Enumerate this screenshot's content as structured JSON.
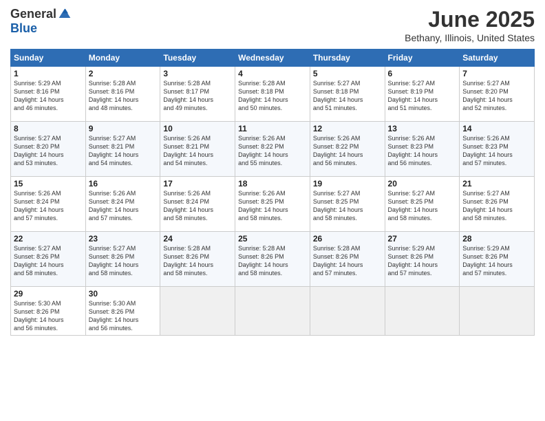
{
  "header": {
    "logo_general": "General",
    "logo_blue": "Blue",
    "month": "June 2025",
    "location": "Bethany, Illinois, United States"
  },
  "weekdays": [
    "Sunday",
    "Monday",
    "Tuesday",
    "Wednesday",
    "Thursday",
    "Friday",
    "Saturday"
  ],
  "weeks": [
    [
      {
        "day": "1",
        "info": "Sunrise: 5:29 AM\nSunset: 8:16 PM\nDaylight: 14 hours\nand 46 minutes."
      },
      {
        "day": "2",
        "info": "Sunrise: 5:28 AM\nSunset: 8:16 PM\nDaylight: 14 hours\nand 48 minutes."
      },
      {
        "day": "3",
        "info": "Sunrise: 5:28 AM\nSunset: 8:17 PM\nDaylight: 14 hours\nand 49 minutes."
      },
      {
        "day": "4",
        "info": "Sunrise: 5:28 AM\nSunset: 8:18 PM\nDaylight: 14 hours\nand 50 minutes."
      },
      {
        "day": "5",
        "info": "Sunrise: 5:27 AM\nSunset: 8:18 PM\nDaylight: 14 hours\nand 51 minutes."
      },
      {
        "day": "6",
        "info": "Sunrise: 5:27 AM\nSunset: 8:19 PM\nDaylight: 14 hours\nand 51 minutes."
      },
      {
        "day": "7",
        "info": "Sunrise: 5:27 AM\nSunset: 8:20 PM\nDaylight: 14 hours\nand 52 minutes."
      }
    ],
    [
      {
        "day": "8",
        "info": "Sunrise: 5:27 AM\nSunset: 8:20 PM\nDaylight: 14 hours\nand 53 minutes."
      },
      {
        "day": "9",
        "info": "Sunrise: 5:27 AM\nSunset: 8:21 PM\nDaylight: 14 hours\nand 54 minutes."
      },
      {
        "day": "10",
        "info": "Sunrise: 5:26 AM\nSunset: 8:21 PM\nDaylight: 14 hours\nand 54 minutes."
      },
      {
        "day": "11",
        "info": "Sunrise: 5:26 AM\nSunset: 8:22 PM\nDaylight: 14 hours\nand 55 minutes."
      },
      {
        "day": "12",
        "info": "Sunrise: 5:26 AM\nSunset: 8:22 PM\nDaylight: 14 hours\nand 56 minutes."
      },
      {
        "day": "13",
        "info": "Sunrise: 5:26 AM\nSunset: 8:23 PM\nDaylight: 14 hours\nand 56 minutes."
      },
      {
        "day": "14",
        "info": "Sunrise: 5:26 AM\nSunset: 8:23 PM\nDaylight: 14 hours\nand 57 minutes."
      }
    ],
    [
      {
        "day": "15",
        "info": "Sunrise: 5:26 AM\nSunset: 8:24 PM\nDaylight: 14 hours\nand 57 minutes."
      },
      {
        "day": "16",
        "info": "Sunrise: 5:26 AM\nSunset: 8:24 PM\nDaylight: 14 hours\nand 57 minutes."
      },
      {
        "day": "17",
        "info": "Sunrise: 5:26 AM\nSunset: 8:24 PM\nDaylight: 14 hours\nand 58 minutes."
      },
      {
        "day": "18",
        "info": "Sunrise: 5:26 AM\nSunset: 8:25 PM\nDaylight: 14 hours\nand 58 minutes."
      },
      {
        "day": "19",
        "info": "Sunrise: 5:27 AM\nSunset: 8:25 PM\nDaylight: 14 hours\nand 58 minutes."
      },
      {
        "day": "20",
        "info": "Sunrise: 5:27 AM\nSunset: 8:25 PM\nDaylight: 14 hours\nand 58 minutes."
      },
      {
        "day": "21",
        "info": "Sunrise: 5:27 AM\nSunset: 8:26 PM\nDaylight: 14 hours\nand 58 minutes."
      }
    ],
    [
      {
        "day": "22",
        "info": "Sunrise: 5:27 AM\nSunset: 8:26 PM\nDaylight: 14 hours\nand 58 minutes."
      },
      {
        "day": "23",
        "info": "Sunrise: 5:27 AM\nSunset: 8:26 PM\nDaylight: 14 hours\nand 58 minutes."
      },
      {
        "day": "24",
        "info": "Sunrise: 5:28 AM\nSunset: 8:26 PM\nDaylight: 14 hours\nand 58 minutes."
      },
      {
        "day": "25",
        "info": "Sunrise: 5:28 AM\nSunset: 8:26 PM\nDaylight: 14 hours\nand 58 minutes."
      },
      {
        "day": "26",
        "info": "Sunrise: 5:28 AM\nSunset: 8:26 PM\nDaylight: 14 hours\nand 57 minutes."
      },
      {
        "day": "27",
        "info": "Sunrise: 5:29 AM\nSunset: 8:26 PM\nDaylight: 14 hours\nand 57 minutes."
      },
      {
        "day": "28",
        "info": "Sunrise: 5:29 AM\nSunset: 8:26 PM\nDaylight: 14 hours\nand 57 minutes."
      }
    ],
    [
      {
        "day": "29",
        "info": "Sunrise: 5:30 AM\nSunset: 8:26 PM\nDaylight: 14 hours\nand 56 minutes."
      },
      {
        "day": "30",
        "info": "Sunrise: 5:30 AM\nSunset: 8:26 PM\nDaylight: 14 hours\nand 56 minutes."
      },
      {
        "day": "",
        "info": ""
      },
      {
        "day": "",
        "info": ""
      },
      {
        "day": "",
        "info": ""
      },
      {
        "day": "",
        "info": ""
      },
      {
        "day": "",
        "info": ""
      }
    ]
  ]
}
